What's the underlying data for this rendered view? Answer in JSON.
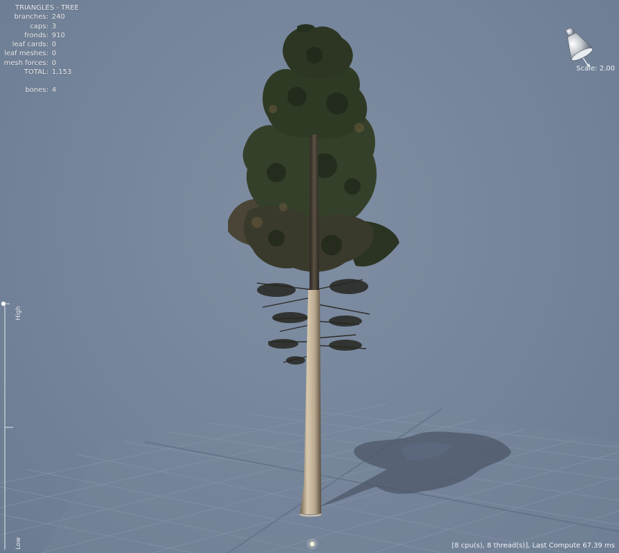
{
  "stats": {
    "title": "TRIANGLES - TREE",
    "rows": [
      {
        "key": "branches:",
        "value": "240"
      },
      {
        "key": "caps:",
        "value": "3"
      },
      {
        "key": "fronds:",
        "value": "910"
      },
      {
        "key": "leaf cards:",
        "value": "0"
      },
      {
        "key": "leaf meshes:",
        "value": "0"
      },
      {
        "key": "mesh forces:",
        "value": "0"
      },
      {
        "key": "TOTAL:",
        "value": "1,153"
      }
    ],
    "bones": {
      "key": "bones:",
      "value": "4"
    }
  },
  "scale_label": "Scale: 2.00",
  "lod": {
    "high_label": "High",
    "low_label": "Low"
  },
  "compute_status": "[8 cpu(s), 8 thread(s)], Last Compute 67.39 ms",
  "icons": {
    "light": "light-direction-icon"
  },
  "colors": {
    "background": "#74849a",
    "grid": "#8a99ad",
    "foliage": "#2e3a24",
    "bark": "#c9b79c"
  }
}
